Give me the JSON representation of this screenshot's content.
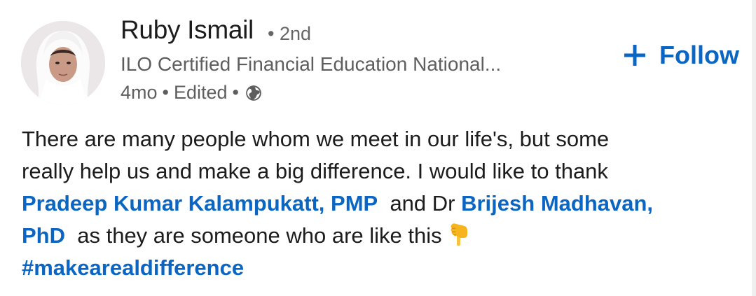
{
  "author": {
    "name": "Ruby Ismail",
    "degree_sep": "•",
    "degree": "2nd",
    "headline": "ILO Certified Financial Education National...",
    "age": "4mo",
    "edited": "Edited",
    "meta_sep": "•",
    "visibility_icon": "globe-icon"
  },
  "follow_button": {
    "icon": "plus-icon",
    "label": "Follow",
    "color": "#0a66c2"
  },
  "post": {
    "line1": "There are many people whom we meet in our life's, but some",
    "line2": "really help us and make a big difference. I would like to thank",
    "mention1": "Pradeep Kumar Kalampukatt, PMP",
    "and_dr": "and Dr",
    "mention2_part1": "Brijesh Madhavan,",
    "mention2_part2": "PhD",
    "line4_rest": "as they are someone who are like this",
    "emoji_icon": "pointing-down-hand-icon",
    "hashtag": "#makearealdifference"
  }
}
